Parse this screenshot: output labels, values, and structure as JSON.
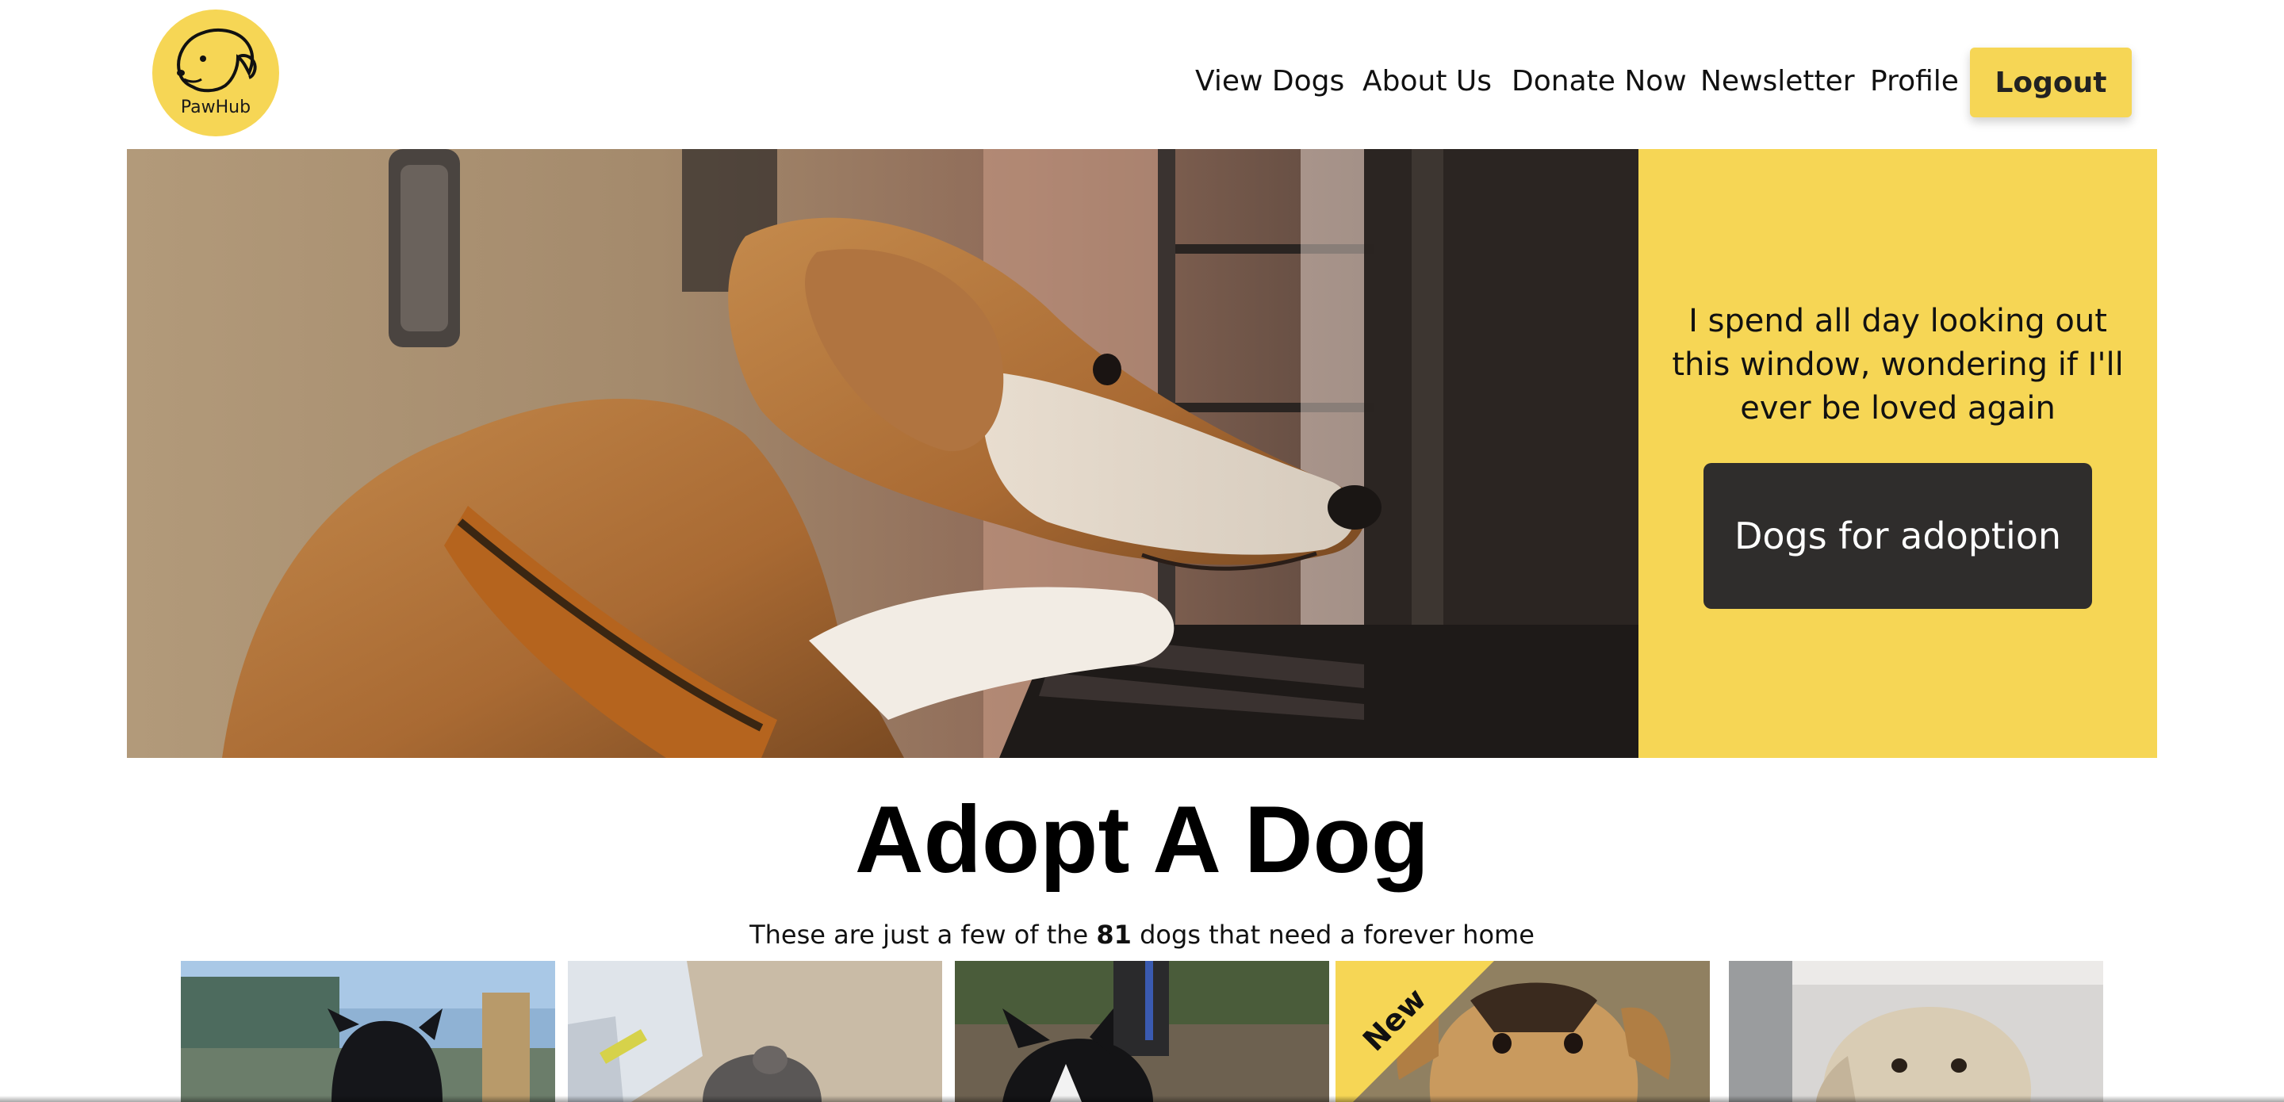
{
  "brand": {
    "name": "PawHub",
    "accent": "#f6d655",
    "dark": "#2f2d2c"
  },
  "nav": {
    "items": [
      {
        "label": "View Dogs"
      },
      {
        "label": "About Us"
      },
      {
        "label": "Donate Now"
      },
      {
        "label": "Newsletter"
      },
      {
        "label": "Profile"
      }
    ],
    "logout_label": "Logout"
  },
  "hero": {
    "quote": "I spend all day looking out this window, wondering if I'll ever be loved again",
    "cta_label": "Dogs for adoption"
  },
  "section": {
    "title": "Adopt A Dog",
    "subtitle_prefix": "These are just a few of the",
    "dog_count": "81",
    "subtitle_suffix": "dogs that need a forever home"
  },
  "cards": {
    "badge": "New"
  }
}
